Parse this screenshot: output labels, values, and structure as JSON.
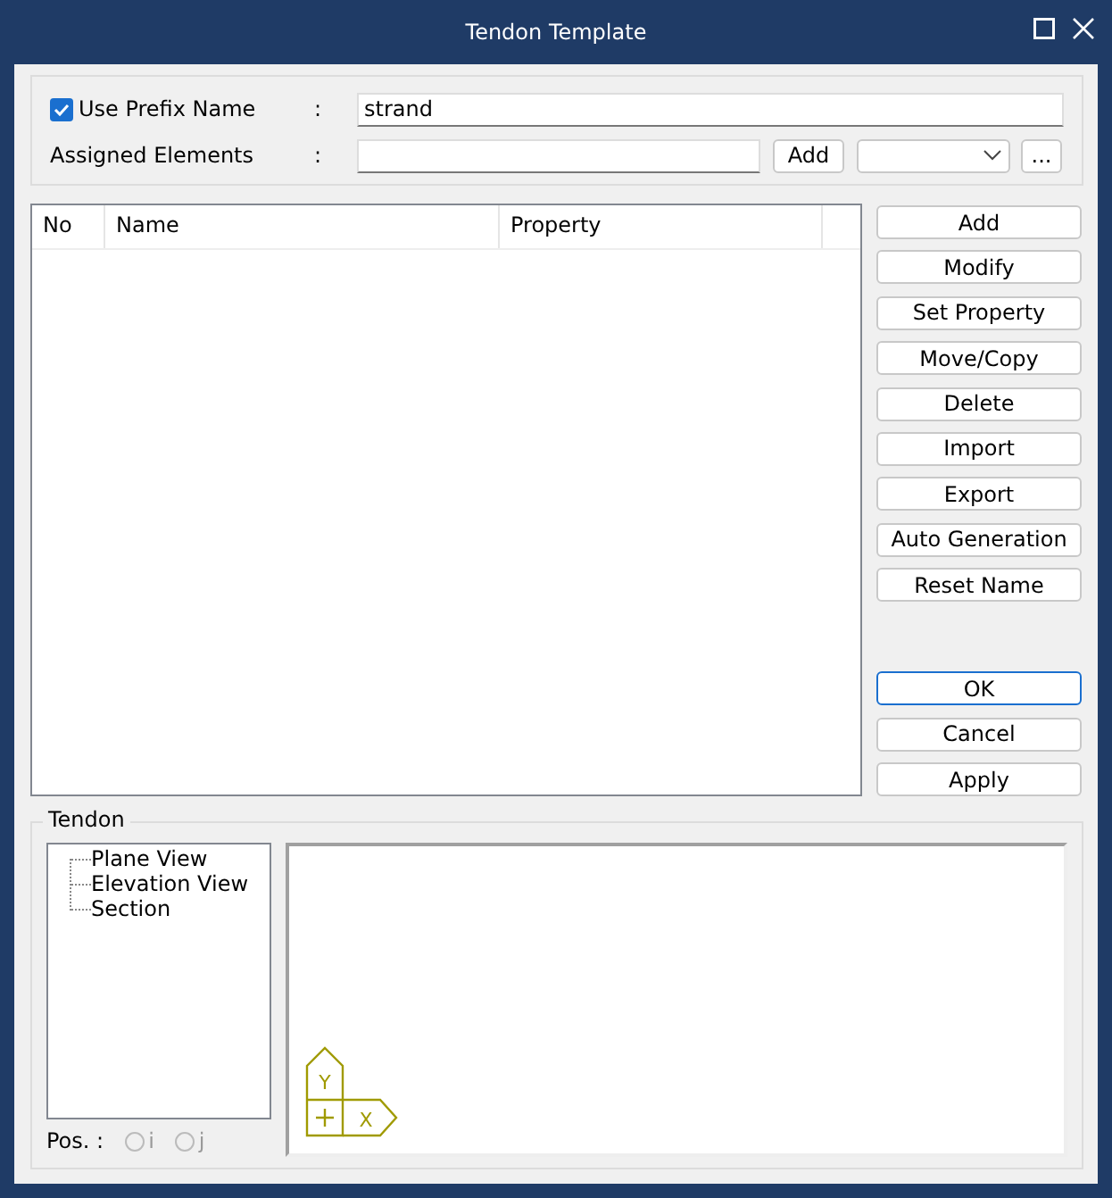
{
  "window": {
    "title": "Tendon Template"
  },
  "prefix": {
    "label": "Use Prefix Name",
    "checked": true,
    "colon": ":",
    "value": "strand"
  },
  "assigned": {
    "label": "Assigned Elements",
    "colon": ":",
    "add_button": "Add",
    "more_button": "..."
  },
  "table": {
    "columns": [
      "No",
      "Name",
      "Property"
    ]
  },
  "actions": [
    {
      "label": "Add",
      "default": false
    },
    {
      "label": "Modify",
      "default": false
    },
    {
      "label": "Set Property",
      "default": false
    },
    {
      "label": "Move/Copy",
      "default": false
    },
    {
      "label": "Delete",
      "default": false
    },
    {
      "label": "Import",
      "default": false
    },
    {
      "label": "Export",
      "default": false
    },
    {
      "label": "Auto Generation",
      "default": false
    },
    {
      "label": "Reset Name",
      "default": false
    }
  ],
  "dialog_buttons": [
    {
      "label": "OK",
      "default": true
    },
    {
      "label": "Cancel",
      "default": false
    },
    {
      "label": "Apply",
      "default": false
    }
  ],
  "tendon": {
    "title": "Tendon",
    "tree": [
      {
        "label": "Plane View"
      },
      {
        "label": "Elevation View"
      },
      {
        "label": "Section"
      }
    ],
    "pos": {
      "label": "Pos. :",
      "options": [
        {
          "label": "i",
          "selected": false,
          "disabled": true
        },
        {
          "label": "j",
          "selected": false,
          "disabled": true
        }
      ]
    },
    "axes": {
      "y_label": "Y",
      "x_label": "X"
    }
  }
}
